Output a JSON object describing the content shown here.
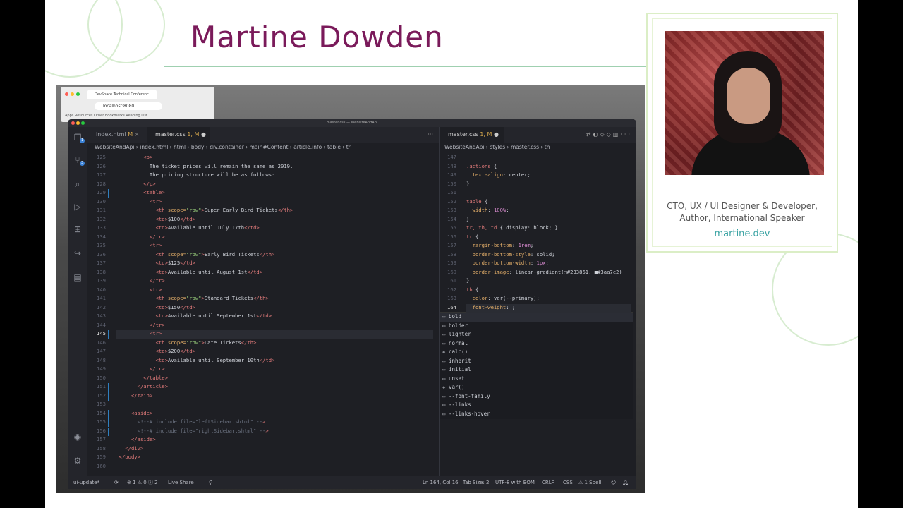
{
  "slide": {
    "speaker_name": "Martine Dowden",
    "card_title_line1": "CTO, UX / UI Designer & Developer,",
    "card_title_line2": "Author, International Speaker",
    "card_link": "martine.dev"
  },
  "browser": {
    "tab_title": "DevSpace Technical Conferenc",
    "url": "localhost:8080",
    "bookmarks": "Apps   Resources   Other Bookmarks   Reading List"
  },
  "vscode": {
    "window_title": "master.css — WebsiteAndApi",
    "left_tabs": [
      {
        "label": "index.html",
        "flag": "M"
      },
      {
        "label": "master.css",
        "flag": "1, M"
      }
    ],
    "right_tab": {
      "label": "master.css",
      "flag": "1, M"
    },
    "left_breadcrumb": "WebsiteAndApi  ›  index.html  ›  html  ›  body  ›  div.container  ›  main#Content  ›  article.info  ›  table  ›  tr",
    "right_breadcrumb": "WebsiteAndApi  ›  styles  ›  master.css  ›  th",
    "left_lines": [
      {
        "n": "125",
        "code": "          <p>"
      },
      {
        "n": "126",
        "code": "            The ticket prices will remain the same as 2019."
      },
      {
        "n": "127",
        "code": "            The pricing structure will be as follows:"
      },
      {
        "n": "128",
        "code": "          </p>"
      },
      {
        "n": "129",
        "code": "          <table>"
      },
      {
        "n": "130",
        "code": "            <tr>"
      },
      {
        "n": "131",
        "code": "              <th scope=\"row\">Super Early Bird Tickets</th>"
      },
      {
        "n": "132",
        "code": "              <td>$100</td>"
      },
      {
        "n": "133",
        "code": "              <td>Available until July 17th</td>"
      },
      {
        "n": "134",
        "code": "            </tr>"
      },
      {
        "n": "135",
        "code": "            <tr>"
      },
      {
        "n": "136",
        "code": "              <th scope=\"row\">Early Bird Tickets</th>"
      },
      {
        "n": "137",
        "code": "              <td>$125</td>"
      },
      {
        "n": "138",
        "code": "              <td>Available until August 1st</td>"
      },
      {
        "n": "139",
        "code": "            </tr>"
      },
      {
        "n": "140",
        "code": "            <tr>"
      },
      {
        "n": "141",
        "code": "              <th scope=\"row\">Standard Tickets</th>"
      },
      {
        "n": "142",
        "code": "              <td>$150</td>"
      },
      {
        "n": "143",
        "code": "              <td>Available until September 1st</td>"
      },
      {
        "n": "144",
        "code": "            </tr>"
      },
      {
        "n": "145",
        "code": "            <tr>"
      },
      {
        "n": "146",
        "code": "              <th scope=\"row\">Late Tickets</th>"
      },
      {
        "n": "147",
        "code": "              <td>$200</td>"
      },
      {
        "n": "148",
        "code": "              <td>Available until September 10th</td>"
      },
      {
        "n": "149",
        "code": "            </tr>"
      },
      {
        "n": "150",
        "code": "          </table>"
      },
      {
        "n": "151",
        "code": "        </article>"
      },
      {
        "n": "152",
        "code": "      </main>"
      },
      {
        "n": "153",
        "code": ""
      },
      {
        "n": "154",
        "code": "      <aside>"
      },
      {
        "n": "155",
        "code": "        <!--# include file=\"leftSidebar.shtml\" -->"
      },
      {
        "n": "156",
        "code": "        <!--# include file=\"rightSidebar.shtml\" -->"
      },
      {
        "n": "157",
        "code": "      </aside>"
      },
      {
        "n": "158",
        "code": "    </div>"
      },
      {
        "n": "159",
        "code": "  </body>"
      },
      {
        "n": "160",
        "code": ""
      }
    ],
    "right_lines": [
      {
        "n": "147",
        "code": ""
      },
      {
        "n": "148",
        "code": ".actions {"
      },
      {
        "n": "149",
        "code": "  text-align: center;"
      },
      {
        "n": "150",
        "code": "}"
      },
      {
        "n": "151",
        "code": ""
      },
      {
        "n": "152",
        "code": "table {"
      },
      {
        "n": "153",
        "code": "  width: 100%;"
      },
      {
        "n": "154",
        "code": "}"
      },
      {
        "n": "155",
        "code": "tr, th, td { display: block; }"
      },
      {
        "n": "156",
        "code": "tr {"
      },
      {
        "n": "157",
        "code": "  margin-bottom: 1rem;"
      },
      {
        "n": "158",
        "code": "  border-bottom-style: solid;"
      },
      {
        "n": "159",
        "code": "  border-bottom-width: 1px;"
      },
      {
        "n": "160",
        "code": "  border-image: linear-gradient(▢#233861, ■#3aa7c2)"
      },
      {
        "n": "161",
        "code": "}"
      },
      {
        "n": "162",
        "code": "th {"
      },
      {
        "n": "163",
        "code": "  color: var(--primary);"
      },
      {
        "n": "164",
        "code": "  font-weight: ;"
      }
    ],
    "suggestions": [
      {
        "icon": "▭",
        "label": "bold"
      },
      {
        "icon": "▭",
        "label": "bolder"
      },
      {
        "icon": "▭",
        "label": "lighter"
      },
      {
        "icon": "▭",
        "label": "normal"
      },
      {
        "icon": "◈",
        "label": "calc()"
      },
      {
        "icon": "▭",
        "label": "inherit"
      },
      {
        "icon": "▭",
        "label": "initial"
      },
      {
        "icon": "▭",
        "label": "unset"
      },
      {
        "icon": "◈",
        "label": "var()"
      },
      {
        "icon": "▭",
        "label": "--font-family"
      },
      {
        "icon": "▭",
        "label": "--links"
      },
      {
        "icon": "▭",
        "label": "--links-hover"
      }
    ],
    "status": {
      "branch": "ui-update*",
      "problems": "⊗ 1  ⚠ 0  ⓘ 2",
      "live_share": "Live Share",
      "position": "Ln 164, Col 16",
      "tab_size": "Tab Size: 2",
      "encoding": "UTF-8 with BOM",
      "eol": "CRLF",
      "language": "CSS",
      "spell": "⚠ 1 Spell"
    }
  }
}
